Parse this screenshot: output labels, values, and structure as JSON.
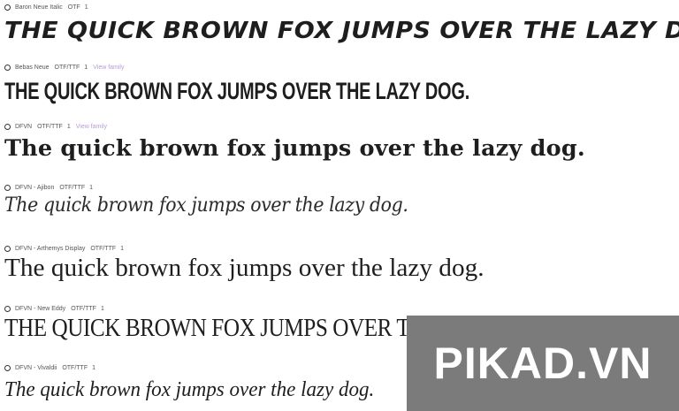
{
  "fonts": [
    {
      "name": "Baron Neue Italic",
      "format": "OTF",
      "count": "1",
      "view_link": "",
      "sample": "The quick brown fox jumps over the lazy dog."
    },
    {
      "name": "Bebas Neue",
      "format": "OTF/TTF",
      "count": "1",
      "view_link": "View family",
      "sample": "The quick brown fox jumps over the lazy dog."
    },
    {
      "name": "DFVN",
      "format": "OTF/TTF",
      "count": "1",
      "view_link": "View family",
      "sample": "The quick brown fox jumps over the lazy dog."
    },
    {
      "name": "DFVN - Ajibon",
      "format": "OTF/TTF",
      "count": "1",
      "view_link": "",
      "sample": "The quick brown fox jumps over the lazy dog."
    },
    {
      "name": "DFVN - Arthemys Display",
      "format": "OTF/TTF",
      "count": "1",
      "view_link": "",
      "sample": "The quick brown fox jumps over the lazy dog."
    },
    {
      "name": "DFVN - New Eddy",
      "format": "OTF/TTF",
      "count": "1",
      "view_link": "",
      "sample": "The quick brown fox jumps over the lazy dog."
    },
    {
      "name": "DFVN - Vivaldii",
      "format": "OTF/TTF",
      "count": "1",
      "view_link": "",
      "sample": "The quick brown fox jumps over the lazy dog."
    }
  ],
  "watermark": {
    "text": "PIKAD.VN"
  },
  "colors": {
    "link": "#b79ad8",
    "watermark_bg": "#7b7b7b",
    "text": "#1e1e1e"
  }
}
